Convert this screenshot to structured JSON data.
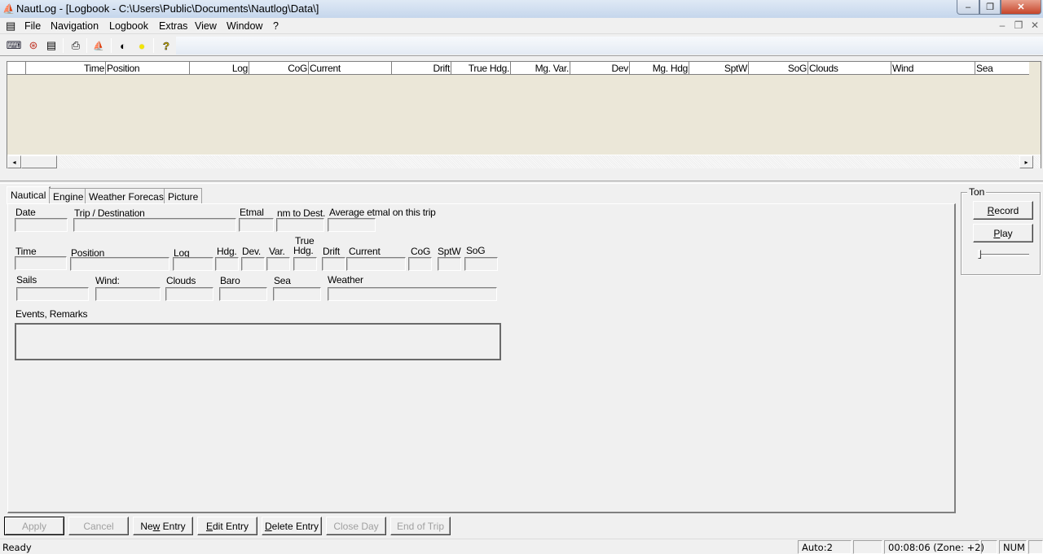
{
  "window": {
    "title": "NautLog - [Logbook - C:\\Users\\Public\\Documents\\Nautlog\\Data\\]",
    "app_icon": "nautlog-app-icon",
    "controls": {
      "minimize": "–",
      "maximize": "❐",
      "close": "✕"
    }
  },
  "menubar": {
    "items": [
      "File",
      "Navigation",
      "Logbook",
      "Extras",
      "View",
      "Window",
      "?"
    ],
    "mdi_controls": {
      "minimize": "–",
      "restore": "❐",
      "close": "✕"
    }
  },
  "toolbar": {
    "buttons": [
      {
        "name": "connect-gps-icon",
        "glyph": "⌨"
      },
      {
        "name": "lifebuoy-icon",
        "glyph": "⊛"
      },
      {
        "name": "logbook-icon",
        "glyph": "▤"
      },
      {
        "name": "print-icon",
        "glyph": "⎙"
      },
      {
        "name": "nautlog-icon",
        "glyph": "⛵"
      },
      {
        "name": "night-mode-icon",
        "glyph": "◐"
      },
      {
        "name": "day-mode-icon",
        "glyph": "●"
      },
      {
        "name": "help-icon",
        "glyph": "?"
      }
    ]
  },
  "grid": {
    "columns": [
      "",
      "Time",
      "Position",
      "Log",
      "CoG",
      "Current",
      "Drift",
      "True Hdg.",
      "Mg. Var.",
      "Dev",
      "Mg. Hdg",
      "SptW",
      "SoG",
      "Clouds",
      "Wind",
      "Sea"
    ],
    "rows": [],
    "scroll_left": "◂",
    "scroll_right": "▸"
  },
  "tabs": [
    "Nautical",
    "Engine",
    "Weather Forecast",
    "Picture"
  ],
  "active_tab": "Nautical",
  "form": {
    "row1": {
      "date": {
        "label": "Date",
        "value": ""
      },
      "trip": {
        "label": "Trip / Destination",
        "value": ""
      },
      "etmal": {
        "label": "Etmal",
        "value": ""
      },
      "nm_to_dest": {
        "label": "nm to Dest.",
        "value": ""
      },
      "avg_etmal": {
        "label": "Average etmal on this trip",
        "value": ""
      }
    },
    "row2": {
      "time": {
        "label": "Time",
        "value": ""
      },
      "position": {
        "label": "Position",
        "value": ""
      },
      "log": {
        "label": "Log",
        "value": ""
      },
      "hdg": {
        "label": "Hdg.",
        "value": ""
      },
      "dev": {
        "label": "Dev.",
        "value": ""
      },
      "var": {
        "label": "Var.",
        "value": ""
      },
      "true_hdg": {
        "label_1": "True",
        "label_2": "Hdg.",
        "value": ""
      },
      "drift": {
        "label": "Drift",
        "value": ""
      },
      "current": {
        "label": "Current",
        "value": ""
      },
      "cog": {
        "label": "CoG",
        "value": ""
      },
      "sptw": {
        "label": "SptW",
        "value": ""
      },
      "sog": {
        "label": "SoG",
        "value": ""
      }
    },
    "row3": {
      "sails": {
        "label": "Sails",
        "value": ""
      },
      "wind": {
        "label": "Wind:",
        "value": ""
      },
      "clouds": {
        "label": "Clouds",
        "value": ""
      },
      "baro": {
        "label": "Baro",
        "value": ""
      },
      "sea": {
        "label": "Sea",
        "value": ""
      },
      "weather": {
        "label": "Weather",
        "value": ""
      }
    },
    "remarks": {
      "label": "Events, Remarks",
      "value": ""
    }
  },
  "ton": {
    "legend": "Ton",
    "record_prefix": "",
    "record_ul": "R",
    "record_rest": "ecord",
    "play_ul": "P",
    "play_rest": "lay",
    "volume": 0
  },
  "actions": {
    "apply": "Apply",
    "cancel": "Cancel",
    "new_entry_a": "Ne",
    "new_entry_ul": "w",
    "new_entry_b": " Entry",
    "edit_entry_ul": "E",
    "edit_entry_b": "dit Entry",
    "delete_entry_ul": "D",
    "delete_entry_b": "elete Entry",
    "close_day": "Close Day",
    "end_of_trip": "End of Trip"
  },
  "statusbar": {
    "message": "Ready",
    "auto": "Auto:2",
    "pane2": "",
    "clock": "00:08:06 (Zone: +2)",
    "pane4": "",
    "num": "NUM",
    "pane6": ""
  }
}
